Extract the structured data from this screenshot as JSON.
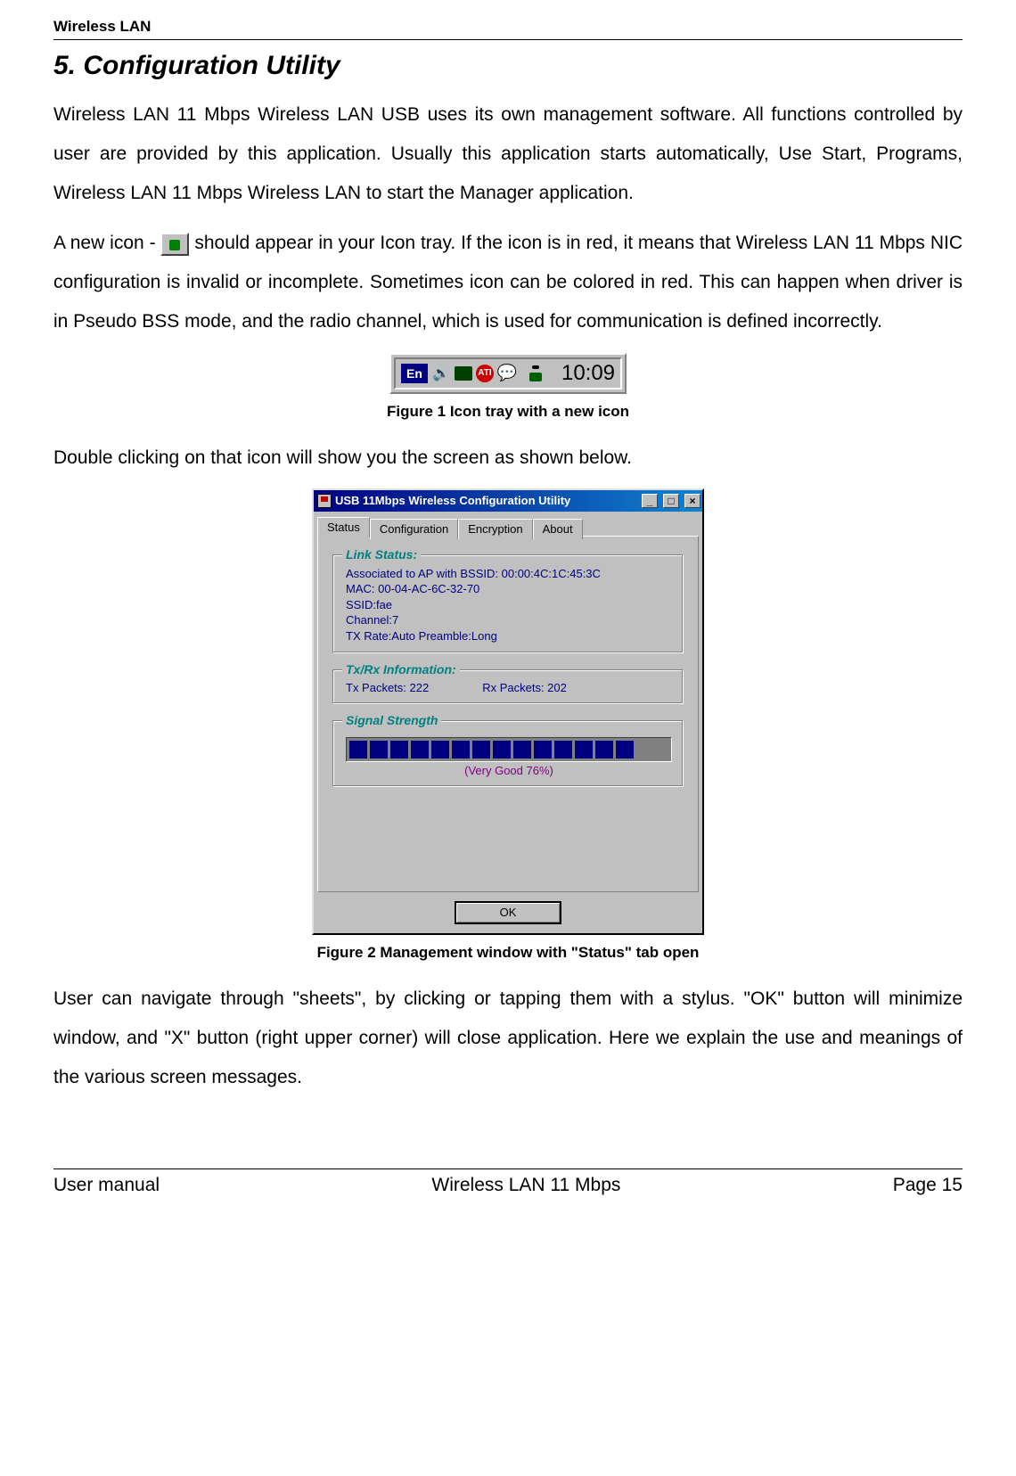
{
  "header": {
    "label": "Wireless LAN"
  },
  "section": {
    "title": "5. Configuration Utility"
  },
  "para1": "Wireless LAN 11 Mbps Wireless LAN USB uses its own management software. All functions controlled by user are provided by this application. Usually this application starts automatically, Use Start, Programs, Wireless LAN 11 Mbps Wireless LAN to start the Manager application.",
  "para2_before": "A new icon - ",
  "para2_after": " should appear in your Icon tray. If the icon is in red, it means that Wireless LAN 11 Mbps NIC configuration is invalid or incomplete. Sometimes icon can be colored in red. This can happen when driver is in Pseudo BSS mode, and the radio channel, which is used for communication is defined incorrectly.",
  "fig1_caption": "Figure 1 Icon tray with a new icon",
  "tray": {
    "lang": "En",
    "time": "10:09",
    "icons": [
      "speaker-icon",
      "monitor-icon",
      "ati-icon",
      "chat-icon",
      "wifi-icon"
    ]
  },
  "para3": "Double clicking on that icon will show you the screen as shown below.",
  "window": {
    "title": "USB 11Mbps Wireless Configuration Utility",
    "tabs": [
      "Status",
      "Configuration",
      "Encryption",
      "About"
    ],
    "active_tab": 0,
    "groups": {
      "link": {
        "legend": "Link Status:",
        "lines": [
          "Associated to AP with BSSID: 00:00:4C:1C:45:3C",
          "MAC: 00-04-AC-6C-32-70",
          "SSID:fae",
          "Channel:7",
          "TX Rate:Auto   Preamble:Long"
        ]
      },
      "txrx": {
        "legend": "Tx/Rx Information:",
        "tx": "Tx Packets: 222",
        "rx": "Rx Packets: 202"
      },
      "signal": {
        "legend": "Signal Strength",
        "segments": 14,
        "label": "(Very Good 76%)"
      }
    },
    "ok_label": "OK",
    "min_glyph": "_",
    "max_glyph": "□",
    "close_glyph": "×"
  },
  "fig2_caption": "Figure 2 Management window with \"Status\" tab open",
  "para4": "User can navigate through \"sheets\", by clicking or tapping them with a stylus. \"OK\" button will minimize window, and \"X\" button (right upper corner) will close application. Here we explain the use and meanings of the various screen messages.",
  "footer": {
    "left": "User manual",
    "center": "Wireless LAN 11 Mbps",
    "right": "Page 15"
  }
}
